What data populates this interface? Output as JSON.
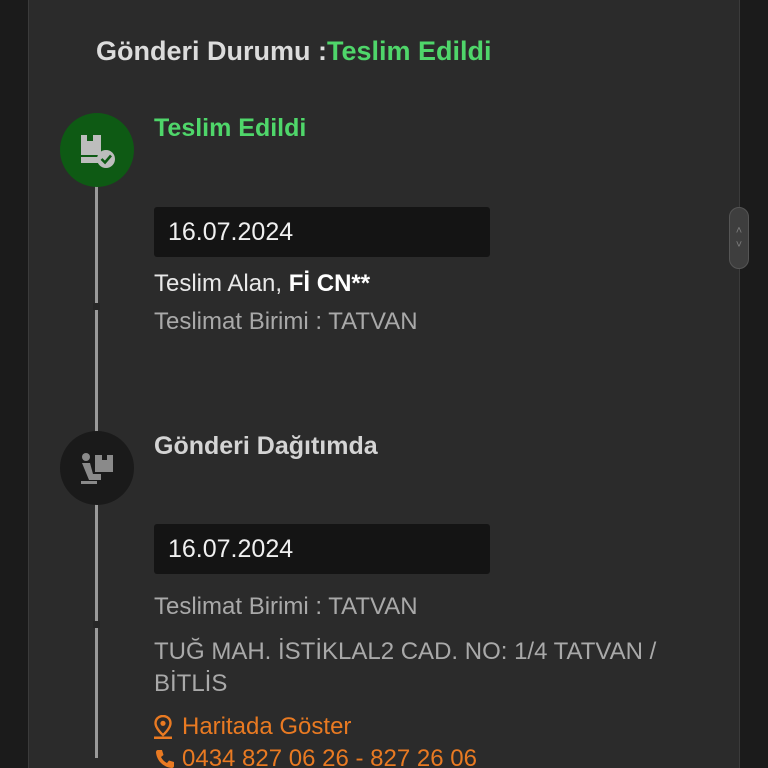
{
  "header": {
    "label": "Gönderi Durumu :",
    "status": "Teslim Edildi"
  },
  "steps": [
    {
      "title": "Teslim Edildi",
      "icon": "package-check-icon",
      "date": "16.07.2024",
      "receiver_label": "Teslim Alan,",
      "receiver_name": "Fİ CN**",
      "unit": "Teslimat Birimi : TATVAN"
    },
    {
      "title": "Gönderi Dağıtımda",
      "icon": "courier-delivery-icon",
      "date": "16.07.2024",
      "unit": "Teslimat Birimi : TATVAN",
      "address": "TUĞ MAH. İSTİKLAL2 CAD. NO: 1/4 TATVAN / BİTLİS",
      "map_link": "Haritada Göster",
      "phone": "0434 827 06 26 - 827 26 06"
    }
  ],
  "colors": {
    "success": "#4fd66a",
    "accent": "#e97a22",
    "background": "#2b2b2b"
  }
}
